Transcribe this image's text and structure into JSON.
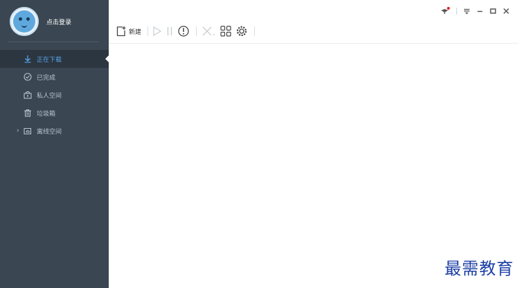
{
  "sidebar": {
    "login_label": "点击登录",
    "items": [
      {
        "label": "正在下载",
        "icon": "download-icon",
        "active": true
      },
      {
        "label": "已完成",
        "icon": "check-circle-icon",
        "active": false
      },
      {
        "label": "私人空间",
        "icon": "lock-folder-icon",
        "active": false
      },
      {
        "label": "垃圾箱",
        "icon": "trash-icon",
        "active": false
      },
      {
        "label": "离线空间",
        "icon": "cloud-folder-icon",
        "active": false,
        "expander": "›"
      }
    ]
  },
  "toolbar": {
    "new_label": "新建",
    "icons": [
      "new-task-icon",
      "play-icon",
      "pause-icon",
      "speed-limit-icon",
      "delete-icon",
      "grid-icon",
      "settings-gear-icon"
    ]
  },
  "window_controls": [
    "notification-icon",
    "menu-icon",
    "minimize-icon",
    "maximize-icon",
    "close-icon"
  ],
  "watermark": "最需教育",
  "colors": {
    "sidebar_bg": "#3a4651",
    "sidebar_active_bg": "#2b3640",
    "accent_blue": "#5aa4e8",
    "notification_dot": "#e02020",
    "watermark": "#1d3fa5"
  }
}
